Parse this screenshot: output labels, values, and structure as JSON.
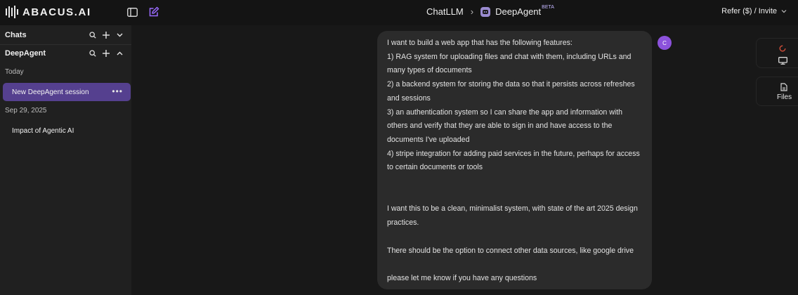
{
  "header": {
    "logo_text": "ABACUS.AI",
    "breadcrumb_root": "ChatLLM",
    "breadcrumb_current": "DeepAgent",
    "beta_badge": "BETA",
    "refer_label": "Refer ($) / Invite"
  },
  "sidebar": {
    "chats_title": "Chats",
    "deepagent_title": "DeepAgent",
    "groups": [
      {
        "label": "Today",
        "items": [
          {
            "label": "New DeepAgent session",
            "active": true
          }
        ]
      },
      {
        "label": "Sep 29, 2025",
        "items": [
          {
            "label": "Impact of Agentic AI",
            "active": false
          }
        ]
      }
    ]
  },
  "message": {
    "avatar_initial": "C",
    "lines": [
      "I want to build a web app that has the following features:",
      "1) RAG system for uploading files and chat with them, including URLs and many types of documents",
      "2) a backend system for storing the data so that it persists across refreshes and sessions",
      "3) an authentication system so I can share the app and information with others and verify that they are able to sign in and have access to the documents I've uploaded",
      "4) stripe integration for adding paid services in the future, perhaps for access to certain documents or tools",
      "",
      "",
      "I want this to be a clean, minimalist system, with state of the art 2025 design practices.",
      "",
      "There should be the option to connect other data sources, like google drive",
      "",
      "please let me know if you have any questions"
    ]
  },
  "right_rail": {
    "files_label": "Files"
  },
  "colors": {
    "accent": "#55408f",
    "avatar": "#8c52dc",
    "background": "#181818",
    "sidebar": "#202020",
    "bubble": "#2b2b2b"
  },
  "icons": [
    "sidebar-toggle-icon",
    "new-chat-icon",
    "chevron-right-icon",
    "deepagent-robot-icon",
    "chevron-down-icon",
    "search-icon",
    "plus-icon",
    "chevron-up-icon",
    "more-icon",
    "refresh-icon",
    "monitor-icon",
    "file-icon"
  ]
}
